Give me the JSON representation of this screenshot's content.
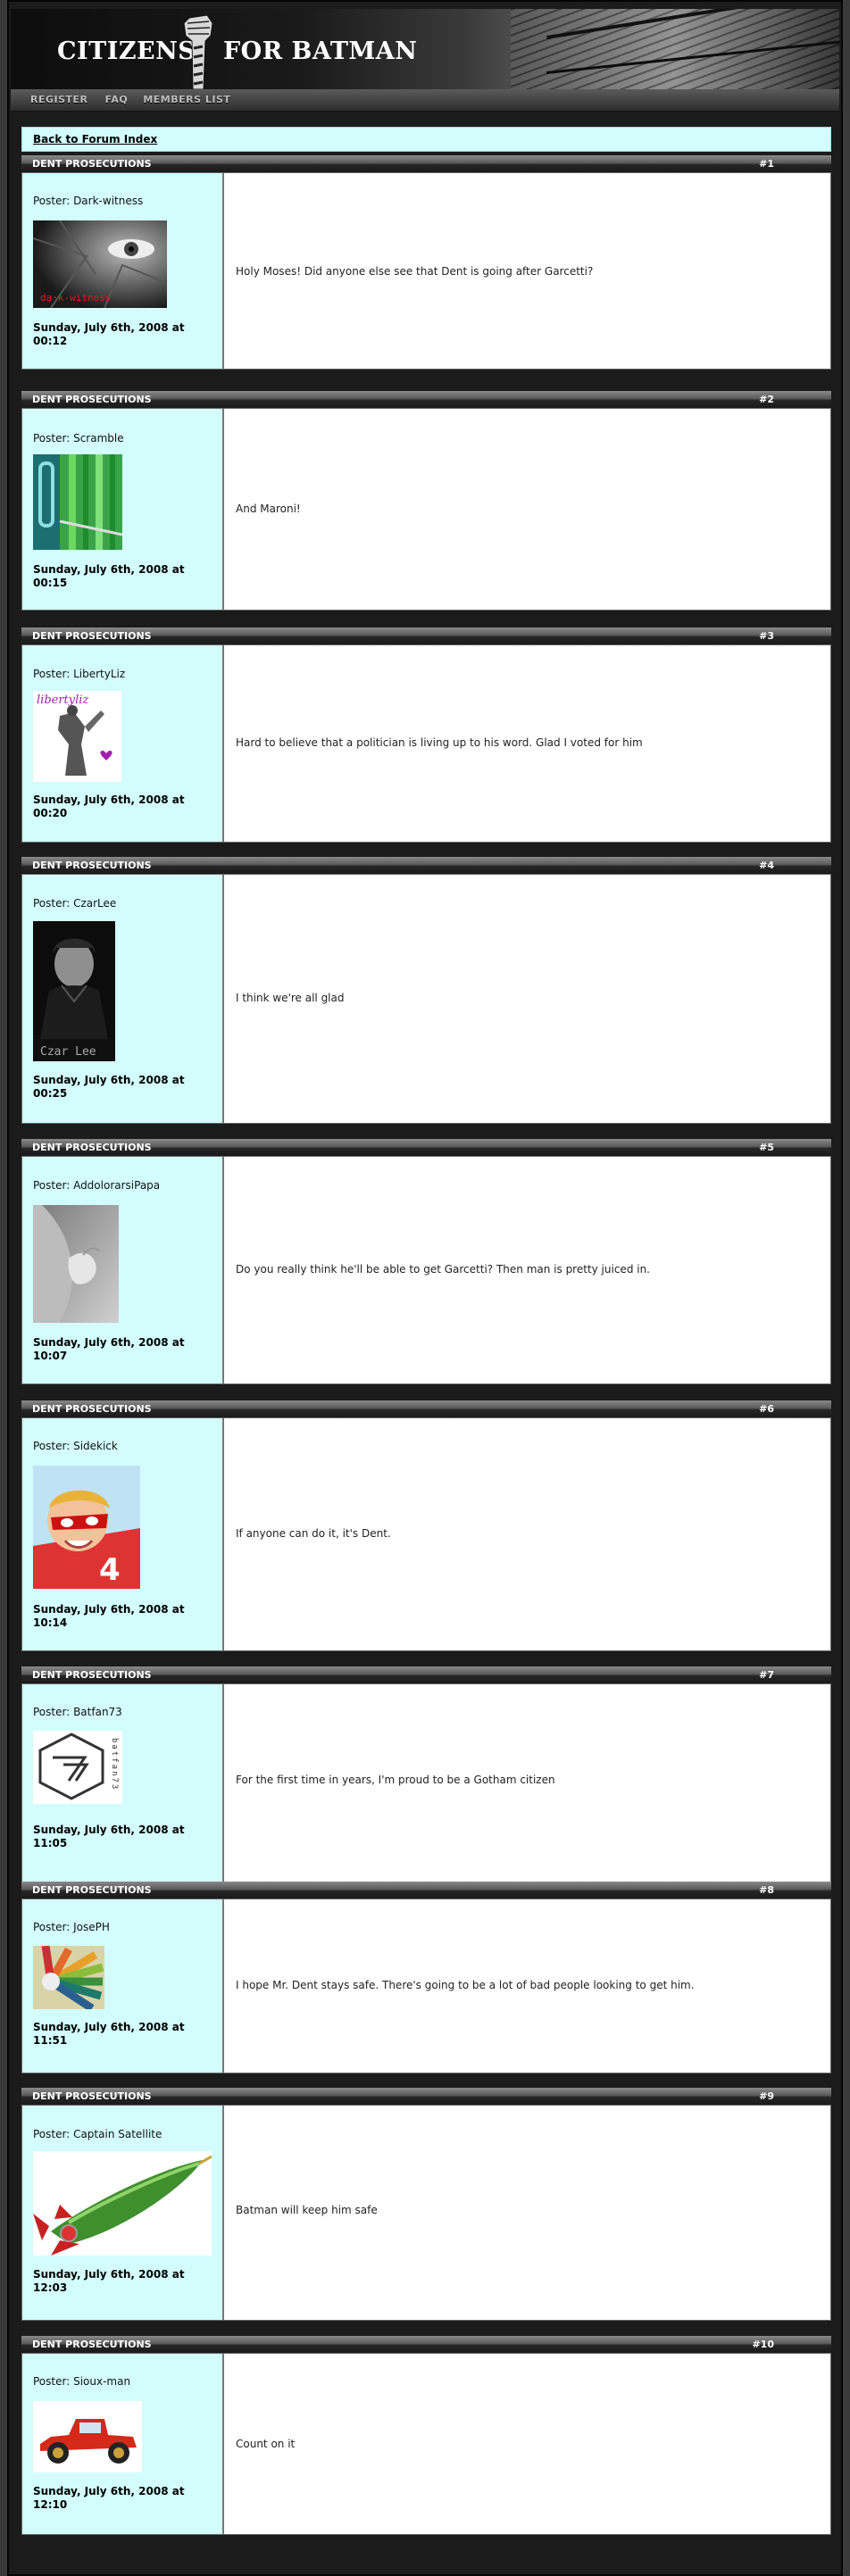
{
  "site": {
    "logo_left": "CITIZENS",
    "logo_right": "FOR BATMAN"
  },
  "nav": {
    "register": "REGISTER",
    "faq": "FAQ",
    "members": "MEMBERS LIST"
  },
  "back_link": "Back to Forum Index",
  "colors": {
    "post_side_bg": "#d3fdfd",
    "frame_bg": "#1b1b1b"
  },
  "posts": [
    {
      "topic": "DENT PROSECUTIONS",
      "num": "#1",
      "poster": "Poster: Dark-witness",
      "date": "Sunday, July 6th, 2008 at 00:12",
      "message": "Holy Moses! Did anyone else see that Dent is going after Garcetti?",
      "avatar_icon": "eye-face-avatar",
      "avatar_caption": "da·k-witness"
    },
    {
      "topic": "DENT PROSECUTIONS",
      "num": "#2",
      "poster": "Poster: Scramble",
      "date": "Sunday, July 6th, 2008 at 00:15",
      "message": "And Maroni!",
      "avatar_icon": "green-rails-avatar"
    },
    {
      "topic": "DENT PROSECUTIONS",
      "num": "#3",
      "poster": "Poster: LibertyLiz",
      "date": "Sunday, July 6th, 2008 at 00:20",
      "message": "Hard to believe that a politician is living up to his word. Glad I voted for him",
      "avatar_icon": "liberty-statue-avatar",
      "avatar_caption": "libertyliz"
    },
    {
      "topic": "DENT PROSECUTIONS",
      "num": "#4",
      "poster": "Poster: CzarLee",
      "date": "Sunday, July 6th, 2008 at 00:25",
      "message": "I think we're all glad",
      "avatar_icon": "man-portrait-avatar",
      "avatar_caption": "Czar Lee"
    },
    {
      "topic": "DENT PROSECUTIONS",
      "num": "#5",
      "poster": "Poster: AddolorarsiPapa",
      "date": "Sunday, July 6th, 2008 at 10:07",
      "message": "Do you really think he'll be able to get Garcetti? Then man is pretty juiced in.",
      "avatar_icon": "hands-avatar"
    },
    {
      "topic": "DENT PROSECUTIONS",
      "num": "#6",
      "poster": "Poster: Sidekick",
      "date": "Sunday, July 6th, 2008 at 10:14",
      "message": "If anyone can do it, it's Dent.",
      "avatar_icon": "kid-hero-avatar"
    },
    {
      "topic": "DENT PROSECUTIONS",
      "num": "#7",
      "poster": "Poster: Batfan73",
      "date": "Sunday, July 6th, 2008 at 11:05",
      "message": "For the first time in years, I'm proud to be a Gotham citizen",
      "avatar_icon": "hexagon-logo-avatar",
      "avatar_caption": "batfan73"
    },
    {
      "topic": "DENT PROSECUTIONS",
      "num": "#8",
      "poster": "Poster: JosePH",
      "date": "Sunday, July 6th, 2008 at 11:51",
      "message": "I hope Mr. Dent stays safe. There's going to be a lot of bad people looking to get him.",
      "avatar_icon": "color-wheel-avatar"
    },
    {
      "topic": "DENT PROSECUTIONS",
      "num": "#9",
      "poster": "Poster: Captain Satellite",
      "date": "Sunday, July 6th, 2008 at 12:03",
      "message": "Batman will keep him safe",
      "avatar_icon": "rocket-avatar"
    },
    {
      "topic": "DENT PROSECUTIONS",
      "num": "#10",
      "poster": "Poster: Sioux-man",
      "date": "Sunday, July 6th, 2008 at 12:10",
      "message": "Count on it",
      "avatar_icon": "red-car-avatar"
    }
  ]
}
